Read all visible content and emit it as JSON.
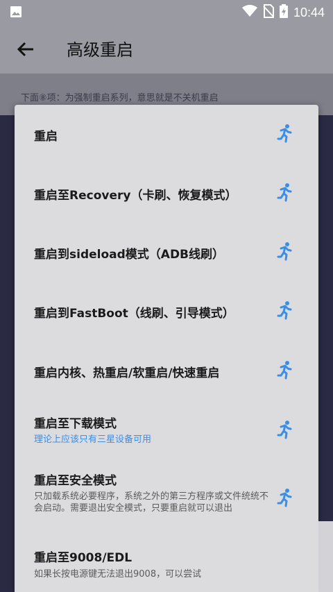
{
  "status_bar": {
    "time": "10:44",
    "icons": [
      "image-icon",
      "wifi-icon",
      "no-sim-icon",
      "battery-charging-icon"
    ]
  },
  "app_bar": {
    "title": "高级重启",
    "back_icon": "arrow-left-icon"
  },
  "background_hint": "下面⑧项：为强制重启系列，意思就是不关机重启",
  "dialog": {
    "items": [
      {
        "label": "重启",
        "description": "",
        "icon": "run-icon"
      },
      {
        "label": "重启至Recovery（卡刷、恢复模式）",
        "description": "",
        "icon": "run-icon"
      },
      {
        "label": "重启到sideload模式（ADB线刷）",
        "description": "",
        "icon": "run-icon"
      },
      {
        "label": "重启到FastBoot（线刷、引导模式）",
        "description": "",
        "icon": "run-icon"
      },
      {
        "label": "重启内核、热重启/软重启/快速重启",
        "description": "",
        "icon": "run-icon"
      },
      {
        "label": "重启至下载模式",
        "description": "理论上应该只有三星设备可用",
        "icon": "run-icon"
      },
      {
        "label": "重启至安全模式",
        "description": "只加载系统必要程序，系统之外的第三方程序或文件统统不会启动。需要退出安全模式，只要重启就可以退出",
        "icon": "run-icon"
      },
      {
        "label": "重启至9008/EDL",
        "description": "如果长按电源键无法退出9008，可以尝试",
        "icon": "run-icon"
      }
    ]
  },
  "colors": {
    "accent": "#3a8ee6",
    "dialog_bg": "#dcdcdf",
    "app_bar_bg": "#9a9aa2"
  }
}
